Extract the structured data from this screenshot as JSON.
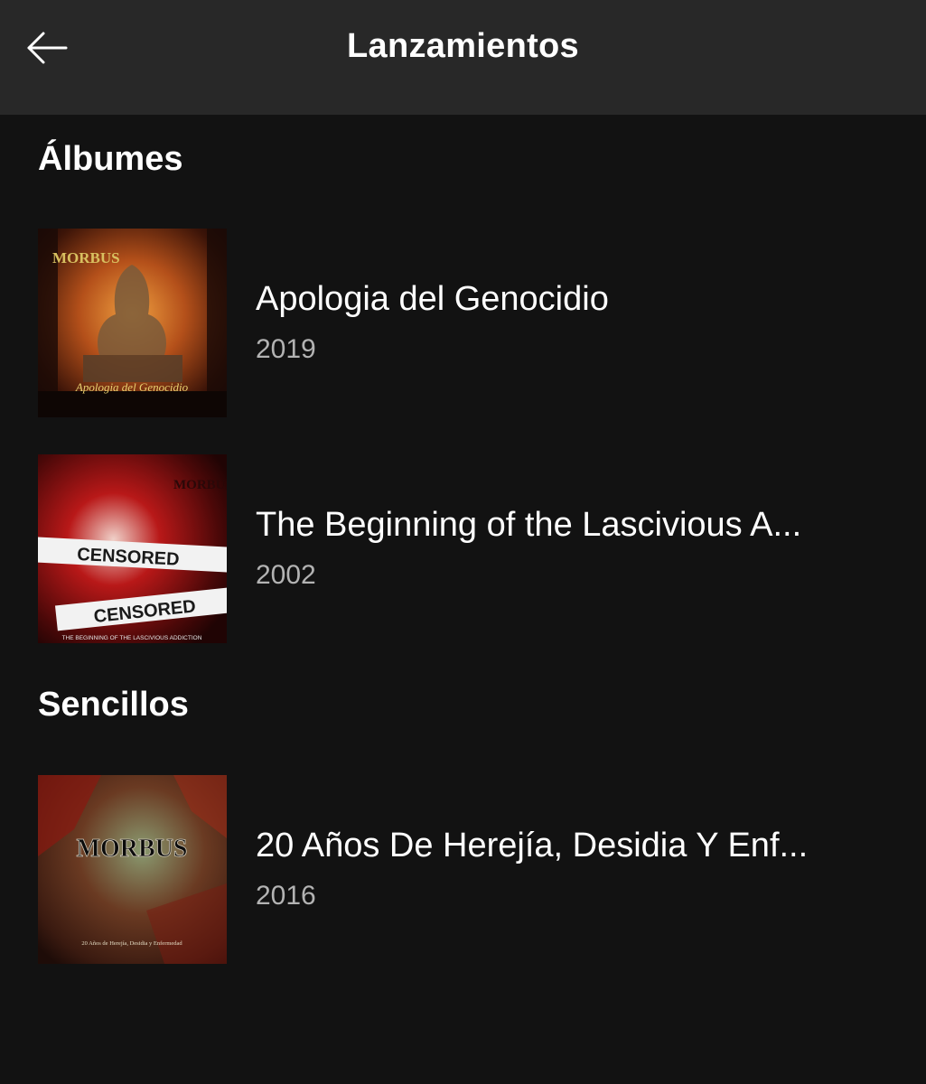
{
  "header": {
    "title": "Lanzamientos",
    "back_icon": "arrow-left-icon"
  },
  "albums": {
    "heading": "Álbumes",
    "items": [
      {
        "title": "Apologia del Genocidio",
        "year": "2019",
        "cover_text": "Apologia del Genocidio",
        "cover_logo": "MORBUS"
      },
      {
        "title": "The Beginning of the Lascivious A...",
        "year": "2002",
        "cover_stamp_1": "CENSORED",
        "cover_stamp_2": "CENSORED",
        "cover_caption": "THE BEGINNING OF THE LASCIVIOUS ADDICTION",
        "cover_logo": "MORBUS"
      }
    ]
  },
  "singles": {
    "heading": "Sencillos",
    "items": [
      {
        "title": "20 Años De Herejía, Desidia Y Enf...",
        "year": "2016",
        "cover_logo": "MORBUS",
        "cover_caption": "20 Años de Herejía, Desidia y Enfermedad"
      }
    ]
  },
  "colors": {
    "background": "#121212",
    "header_bg": "#282828",
    "text_primary": "#ffffff",
    "text_secondary": "#b3b3b3"
  }
}
